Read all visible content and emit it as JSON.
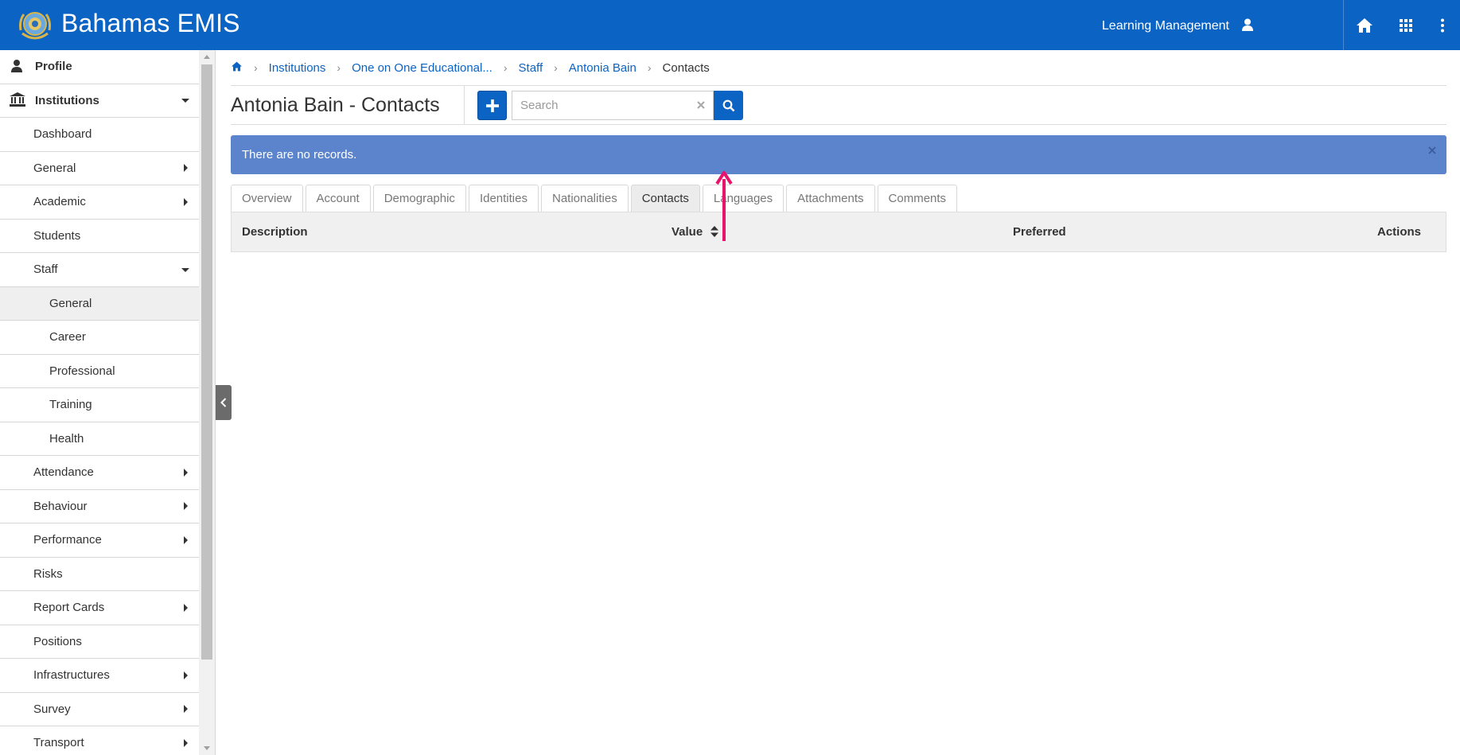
{
  "header": {
    "app_title": "Bahamas EMIS",
    "module_label": "Learning Management",
    "brand_color": "#0b63c4",
    "icons": [
      "user-icon",
      "home-icon",
      "apps-grid-icon",
      "more-vertical-icon"
    ]
  },
  "sidebar": {
    "items": [
      {
        "label": "Profile",
        "level": 0,
        "icon": "user-icon"
      },
      {
        "label": "Institutions",
        "level": 0,
        "icon": "institution-icon",
        "expanded": true
      },
      {
        "label": "Dashboard",
        "level": 1
      },
      {
        "label": "General",
        "level": 1,
        "has_children": true
      },
      {
        "label": "Academic",
        "level": 1,
        "has_children": true
      },
      {
        "label": "Students",
        "level": 1
      },
      {
        "label": "Staff",
        "level": 1,
        "expanded": true
      },
      {
        "label": "General",
        "level": 2,
        "active": true
      },
      {
        "label": "Career",
        "level": 2
      },
      {
        "label": "Professional",
        "level": 2
      },
      {
        "label": "Training",
        "level": 2
      },
      {
        "label": "Health",
        "level": 2
      },
      {
        "label": "Attendance",
        "level": 1,
        "has_children": true
      },
      {
        "label": "Behaviour",
        "level": 1,
        "has_children": true
      },
      {
        "label": "Performance",
        "level": 1,
        "has_children": true
      },
      {
        "label": "Risks",
        "level": 1
      },
      {
        "label": "Report Cards",
        "level": 1,
        "has_children": true
      },
      {
        "label": "Positions",
        "level": 1
      },
      {
        "label": "Infrastructures",
        "level": 1,
        "has_children": true
      },
      {
        "label": "Survey",
        "level": 1,
        "has_children": true
      },
      {
        "label": "Transport",
        "level": 1,
        "has_children": true
      }
    ]
  },
  "breadcrumb": {
    "items": [
      "Institutions",
      "One on One Educational...",
      "Staff",
      "Antonia Bain"
    ],
    "current": "Contacts"
  },
  "page": {
    "title": "Antonia Bain - Contacts",
    "search_placeholder": "Search",
    "search_value": "",
    "alert_text": "There are no records.",
    "alert_color": "#5b84cd"
  },
  "tabs": [
    {
      "label": "Overview"
    },
    {
      "label": "Account"
    },
    {
      "label": "Demographic"
    },
    {
      "label": "Identities"
    },
    {
      "label": "Nationalities"
    },
    {
      "label": "Contacts",
      "active": true
    },
    {
      "label": "Languages"
    },
    {
      "label": "Attachments"
    },
    {
      "label": "Comments"
    }
  ],
  "table": {
    "columns": [
      "Description",
      "Value",
      "Preferred",
      "Actions"
    ],
    "rows": []
  },
  "annotation": {
    "arrow_color": "#e8146c"
  }
}
